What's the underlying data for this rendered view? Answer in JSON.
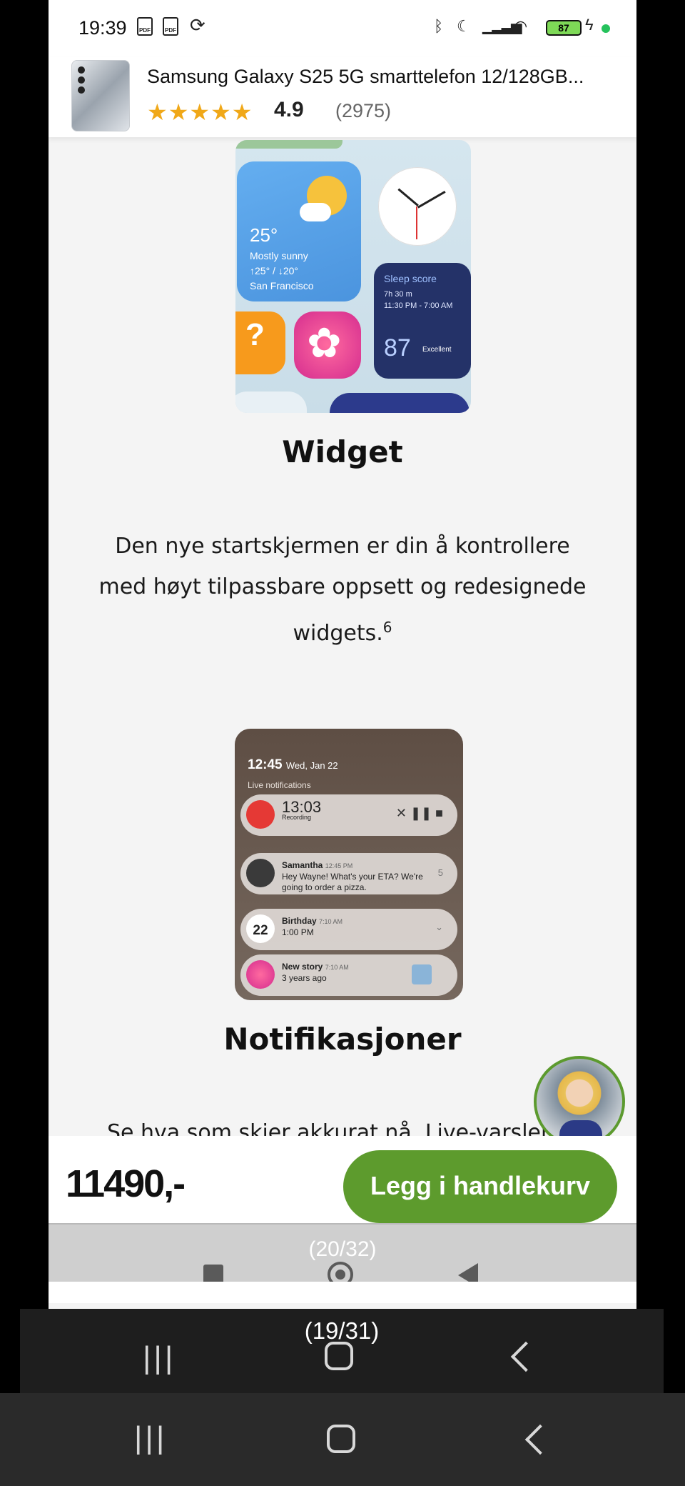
{
  "status_bar": {
    "time": "19:39",
    "battery": "87",
    "icons": [
      "pdf-icon",
      "pdf-icon",
      "sync-icon",
      "bluetooth-icon",
      "moon-icon",
      "signal-icon",
      "wifi-icon",
      "battery-icon",
      "charging-icon"
    ]
  },
  "product": {
    "title": "Samsung Galaxy S25 5G smarttelefon 12/128GB...",
    "stars": "★★★★★",
    "rating": "4.9",
    "reviews": "(2975)"
  },
  "widget_image": {
    "temperature": "25°",
    "condition": "Mostly sunny",
    "range": "↑25° / ↓20°",
    "city": "San Francisco",
    "sleep_label": "Sleep score",
    "sleep_duration": "7h 30 m",
    "sleep_window": "11:30 PM - 7:00 AM",
    "sleep_score": "87",
    "sleep_rating": "Excellent"
  },
  "widget_section": {
    "title": "Widget",
    "text": "Den nye startskjermen er din å kontrollere med høyt tilpassbare oppsett og redesignede widgets.",
    "footnote": "6"
  },
  "notif_image": {
    "time": "12:45",
    "date": "Wed, Jan 22",
    "live_label": "Live notifications",
    "rec_time": "13:03",
    "rec_label": "Recording",
    "msg_name": "Samantha",
    "msg_time": "12:45 PM",
    "msg_text": "Hey Wayne! What's your ETA? We're going to order a pizza.",
    "msg_count": "5",
    "cal_day": "22",
    "cal_title": "Birthday",
    "cal_time": "7:10 AM",
    "cal_sub": "1:00 PM",
    "story_title": "New story",
    "story_time": "7:10 AM",
    "story_sub": "3 years ago"
  },
  "notif_section": {
    "title": "Notifikasjoner",
    "text_cut": "Se hva som skjer akkurat nå. Live-varsler"
  },
  "buy_bar": {
    "price": "11490,-",
    "button": "Legg i handlekurv"
  },
  "inner_nav": {
    "counter": "(20/32)"
  },
  "mid_nav": {
    "counter": "(19/31)"
  }
}
